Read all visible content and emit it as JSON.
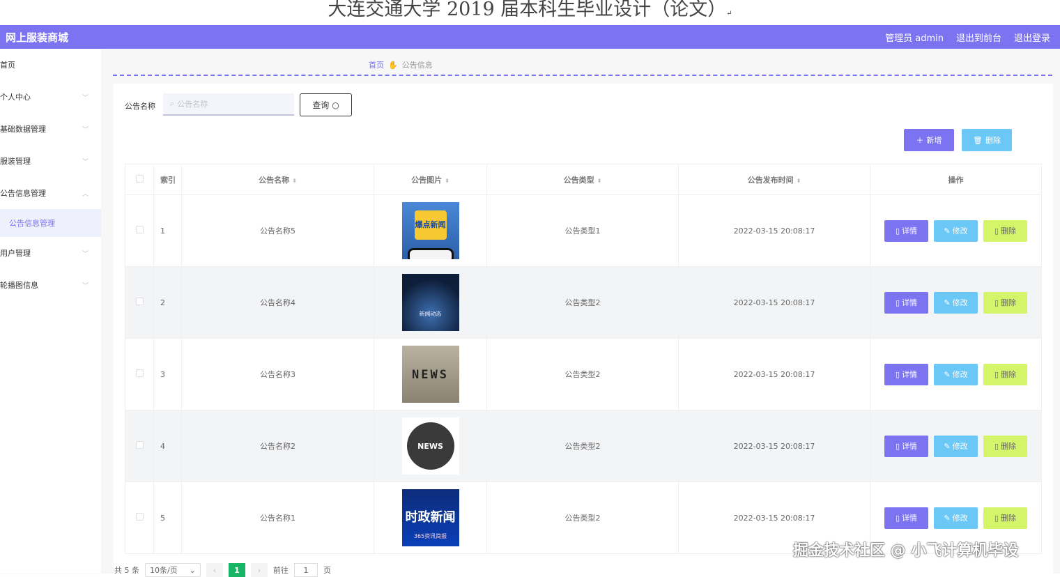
{
  "doc_title": "大连交通大学 2019 届本科生毕业设计（论文）",
  "doc_title_mark": "↵",
  "header": {
    "brand": "网上服装商城",
    "admin_label": "管理员 admin",
    "frontend_link": "退出到前台",
    "logout_link": "退出登录"
  },
  "sidebar": {
    "items": [
      {
        "label": "首页"
      },
      {
        "label": "个人中心"
      },
      {
        "label": "基础数据管理"
      },
      {
        "label": "服装管理"
      },
      {
        "label": "公告信息管理"
      },
      {
        "label": "用户管理"
      },
      {
        "label": "轮播图信息"
      }
    ],
    "active_sub": "公告信息管理"
  },
  "breadcrumb": {
    "home": "首页",
    "current": "公告信息"
  },
  "search": {
    "label": "公告名称",
    "placeholder": "公告名称",
    "button": "查询"
  },
  "toolbar": {
    "add": "新增",
    "delete": "删除"
  },
  "table": {
    "headers": {
      "index": "索引",
      "name": "公告名称",
      "image": "公告图片",
      "type": "公告类型",
      "time": "公告发布时间",
      "ops": "操作"
    },
    "rows": [
      {
        "index": "1",
        "name": "公告名称5",
        "image_text": "爆点新闻",
        "type": "公告类型1",
        "time": "2022-03-15 20:08:17"
      },
      {
        "index": "2",
        "name": "公告名称4",
        "image_text": "新闻动态",
        "type": "公告类型2",
        "time": "2022-03-15 20:08:17"
      },
      {
        "index": "3",
        "name": "公告名称3",
        "image_text": "NEWS",
        "type": "公告类型2",
        "time": "2022-03-15 20:08:17"
      },
      {
        "index": "4",
        "name": "公告名称2",
        "image_text": "NEWS",
        "type": "公告类型2",
        "time": "2022-03-15 20:08:17"
      },
      {
        "index": "5",
        "name": "公告名称1",
        "image_text": "时政新闻",
        "image_subtext": "365资讯简报",
        "type": "公告类型2",
        "time": "2022-03-15 20:08:17"
      }
    ],
    "op_labels": {
      "detail": "详情",
      "edit": "修改",
      "remove": "删除"
    }
  },
  "pagination": {
    "total": "共 5 条",
    "page_size": "10条/页",
    "current_page": "1",
    "goto_label": "前往",
    "goto_value": "1",
    "page_suffix": "页"
  },
  "watermark": "掘金技术社区 @ 小飞计算机毕设",
  "colors": {
    "primary": "#7b73f0",
    "info": "#6bc7f5",
    "warning": "#d4f56a",
    "page_active": "#18b566"
  }
}
